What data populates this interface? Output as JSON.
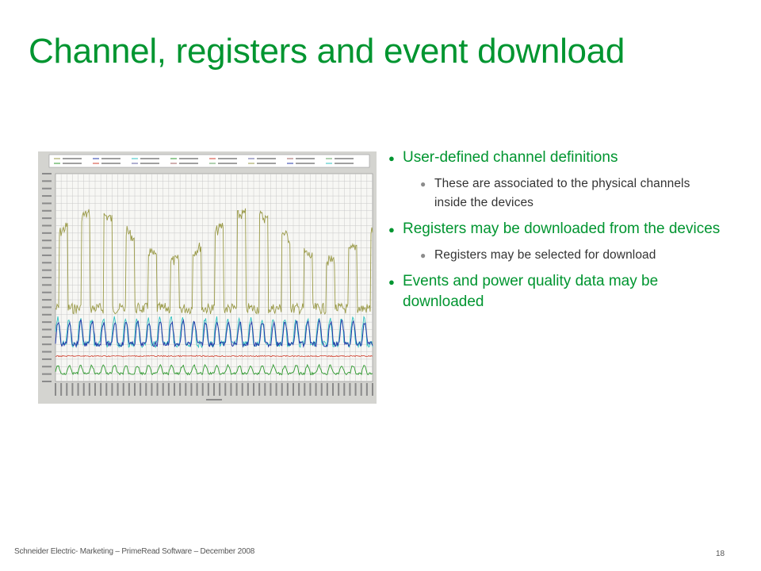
{
  "slide": {
    "title": "Channel, registers and event download"
  },
  "bullets": [
    {
      "level": 1,
      "marker": "●",
      "text": "User-defined channel definitions"
    },
    {
      "level": 2,
      "marker": "●",
      "text": "These are associated to the physical channels inside the devices"
    },
    {
      "level": 1,
      "marker": "●",
      "text": "Registers may be downloaded from the devices"
    },
    {
      "level": 2,
      "marker": "●",
      "text": "Registers may be selected for download"
    },
    {
      "level": 1,
      "marker": "●",
      "text": "Events and power quality data may be downloaded"
    }
  ],
  "footer": {
    "text": "Schneider Electric- Marketing – PrimeRead Software – December 2008",
    "page_number": "18"
  },
  "colors": {
    "accent_green": "#009530",
    "body_text": "#333333",
    "series_olive": "#9a9a48",
    "series_blue": "#243aa8",
    "series_cyan": "#2fc0c0",
    "series_green": "#2f9a2f",
    "series_red": "#d04030"
  },
  "chart_data": {
    "type": "line",
    "note": "Chart labels and values are too small to read in the thumbnail; lines drawn as approximate visual traces only.",
    "series": [
      {
        "color": "#9a9a48"
      },
      {
        "color": "#243aa8"
      },
      {
        "color": "#2fc0c0"
      },
      {
        "color": "#2f9a2f"
      },
      {
        "color": "#d04030"
      }
    ]
  }
}
